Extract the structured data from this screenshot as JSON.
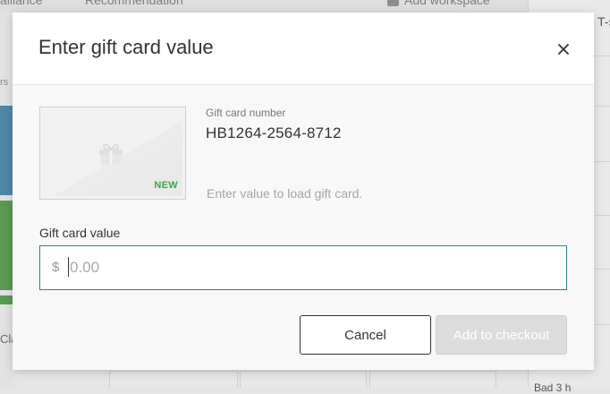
{
  "background": {
    "top_left_text": "alliance",
    "top_mid_text": "Recommendation",
    "add_workspace_label": "Add workspace",
    "right_panel_text": "T-s",
    "right_panel_bottom_text": "Bad 3 h",
    "left_small_text": "rs",
    "left_bottom_text": "Cla"
  },
  "modal": {
    "title": "Enter gift card value",
    "close_icon": "close-icon"
  },
  "gift_card": {
    "image_badge": "NEW",
    "image_icon": "gift-icon",
    "number_label": "Gift card number",
    "number_value": "HB1264-2564-8712",
    "hint": "Enter value to load gift card."
  },
  "value_field": {
    "label": "Gift card value",
    "currency_symbol": "$",
    "placeholder": "0.00",
    "value": ""
  },
  "actions": {
    "cancel_label": "Cancel",
    "add_label": "Add to checkout",
    "add_enabled": false
  },
  "colors": {
    "accent_focus_border": "#2a7f8f",
    "new_badge": "#3aa74b",
    "disabled_button": "#dcdcdc"
  }
}
